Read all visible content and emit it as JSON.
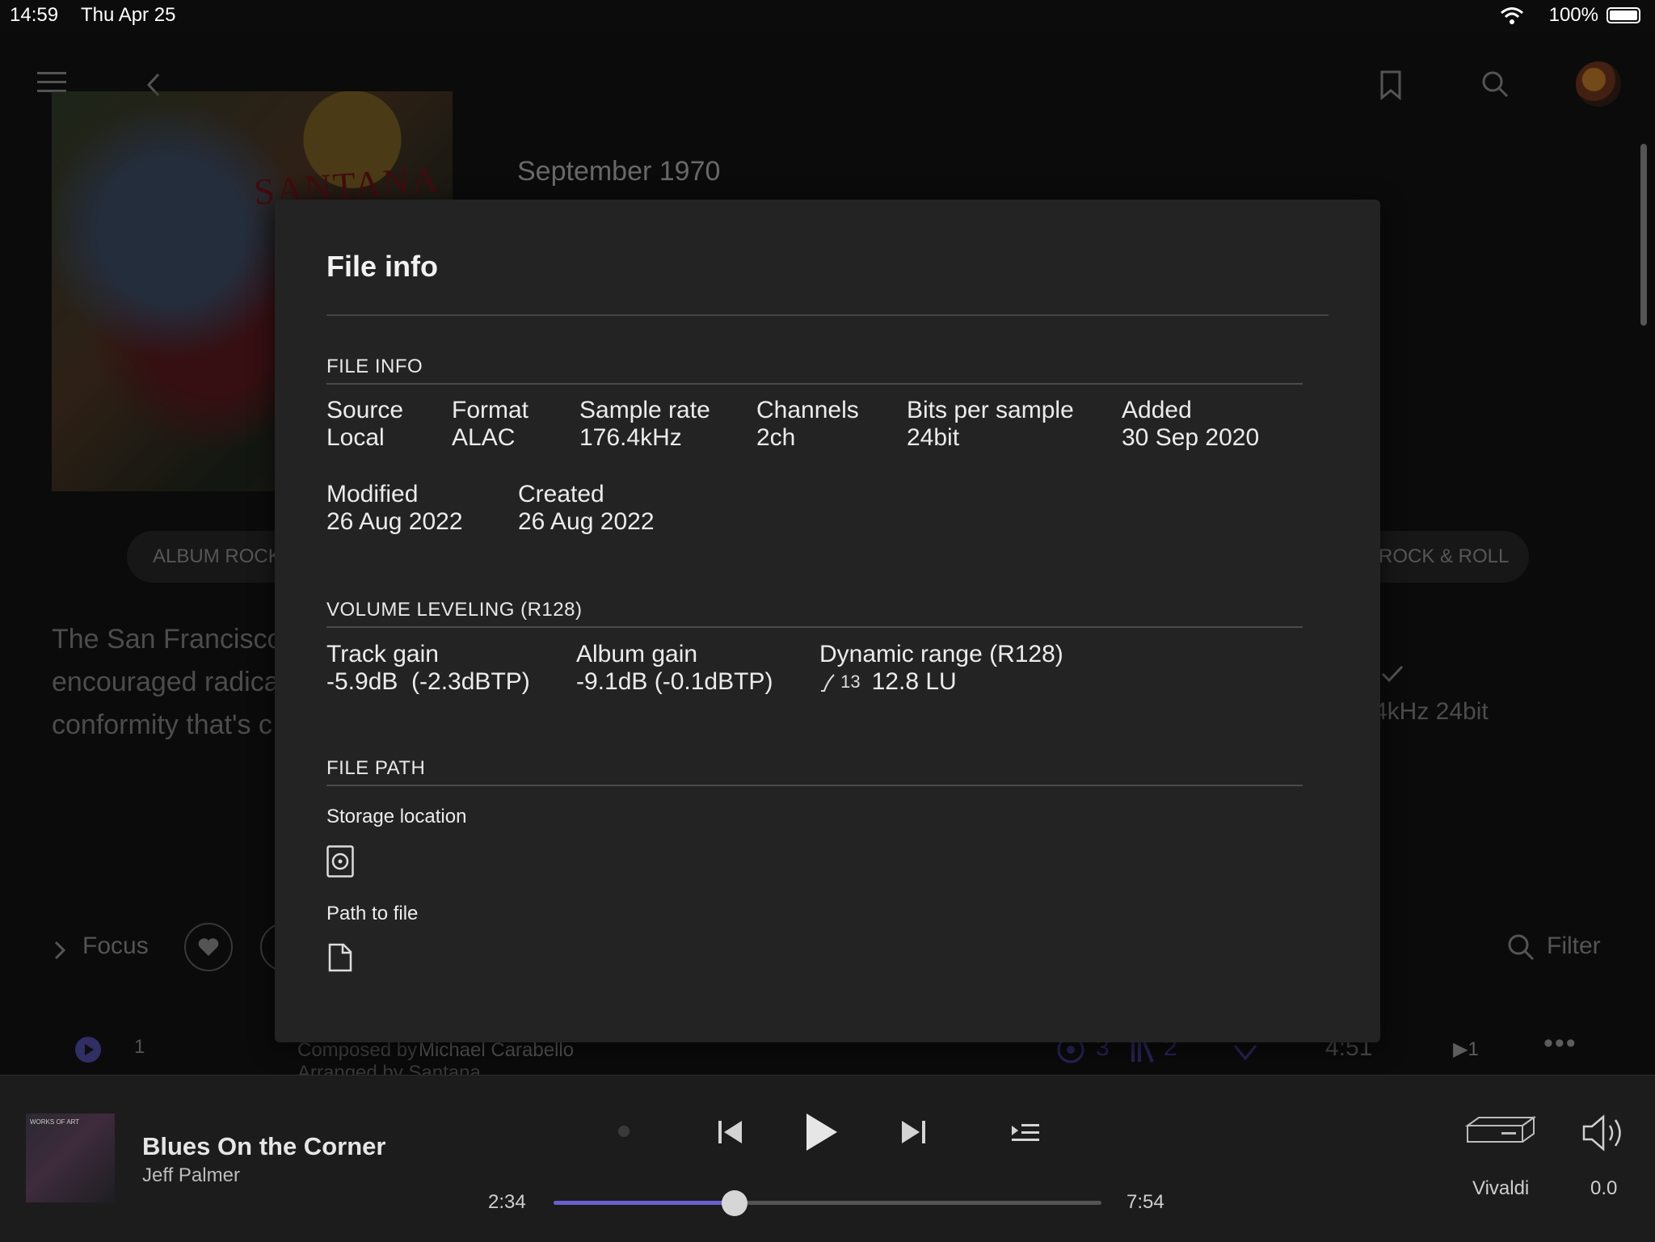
{
  "status_bar": {
    "time": "14:59",
    "date": "Thu Apr 25",
    "battery": "100%"
  },
  "background": {
    "release_date": "September 1970",
    "art_text": "SANTANA",
    "genre_left": "ALBUM ROCK",
    "genre_right": "ROCK & ROLL",
    "description_lines": [
      "The San Francisco",
      "encouraged radical",
      "conformity that's c"
    ],
    "quality_partial": "4kHz 24bit",
    "focus_label": "Focus",
    "filter_label": "Filter",
    "track": {
      "number": "1",
      "composer_prefix": "Composed by",
      "composer": "Michael Carabello",
      "arranger_partial": "Arranged by Santana",
      "plays": "3",
      "versions": "2",
      "duration": "4:51",
      "queue": "1"
    }
  },
  "modal": {
    "title": "File info",
    "file_info": {
      "heading": "FILE INFO",
      "fields": [
        {
          "label": "Source",
          "value": "Local"
        },
        {
          "label": "Format",
          "value": "ALAC"
        },
        {
          "label": "Sample rate",
          "value": "176.4kHz"
        },
        {
          "label": "Channels",
          "value": "2ch"
        },
        {
          "label": "Bits per sample",
          "value": "24bit"
        },
        {
          "label": "Added",
          "value": "30 Sep 2020"
        },
        {
          "label": "Modified",
          "value": "26 Aug 2022"
        },
        {
          "label": "Created",
          "value": "26 Aug 2022"
        }
      ]
    },
    "volume_leveling": {
      "heading": "VOLUME LEVELING (R128)",
      "track_gain_label": "Track gain",
      "track_gain_value": "-5.9dB  (-2.3dBTP)",
      "album_gain_label": "Album gain",
      "album_gain_value": "-9.1dB (-0.1dBTP)",
      "dynamic_range_label": "Dynamic range (R128)",
      "dynamic_range_badge": "13",
      "dynamic_range_value": "12.8 LU"
    },
    "file_path": {
      "heading": "FILE PATH",
      "storage_label": "Storage location",
      "storage_icon": "hard-drive-icon",
      "path_label": "Path to file",
      "path_icon": "file-icon"
    }
  },
  "player": {
    "art_text": "WORKS OF ART",
    "title": "Blues On the Corner",
    "artist": "Jeff Palmer",
    "elapsed": "2:34",
    "total": "7:54",
    "progress": 0.33,
    "device": "Vivaldi",
    "volume": "0.0",
    "accent_color": "#6a5fd3"
  }
}
